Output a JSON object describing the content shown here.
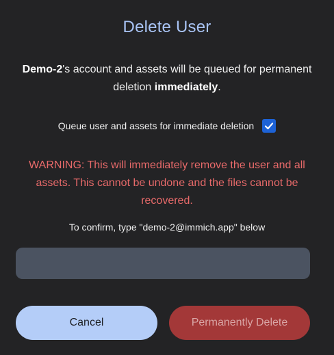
{
  "dialog": {
    "title": "Delete User",
    "description": {
      "username": "Demo-2",
      "text_after_name": "'s account and assets will be queued for permanent deletion ",
      "emphasis": "immediately",
      "period": "."
    },
    "queue_checkbox": {
      "label": "Queue user and assets for immediate deletion",
      "checked": true
    },
    "warning": "WARNING: This will immediately remove the user and all assets. This cannot be undone and the files cannot be recovered.",
    "confirm_prompt": "To confirm, type \"demo-2@immich.app\" below",
    "confirm_input": {
      "value": "",
      "placeholder": ""
    },
    "buttons": {
      "cancel_label": "Cancel",
      "delete_label": "Permanently Delete"
    }
  },
  "colors": {
    "background": "#232325",
    "title": "#a9c4f5",
    "warning": "#e86a6a",
    "checkbox": "#1d62d6",
    "input_bg": "#4b5361",
    "cancel_bg": "#b4cdf8",
    "delete_bg": "#a33838"
  },
  "icons": {
    "checkbox_mark": "check-icon"
  }
}
